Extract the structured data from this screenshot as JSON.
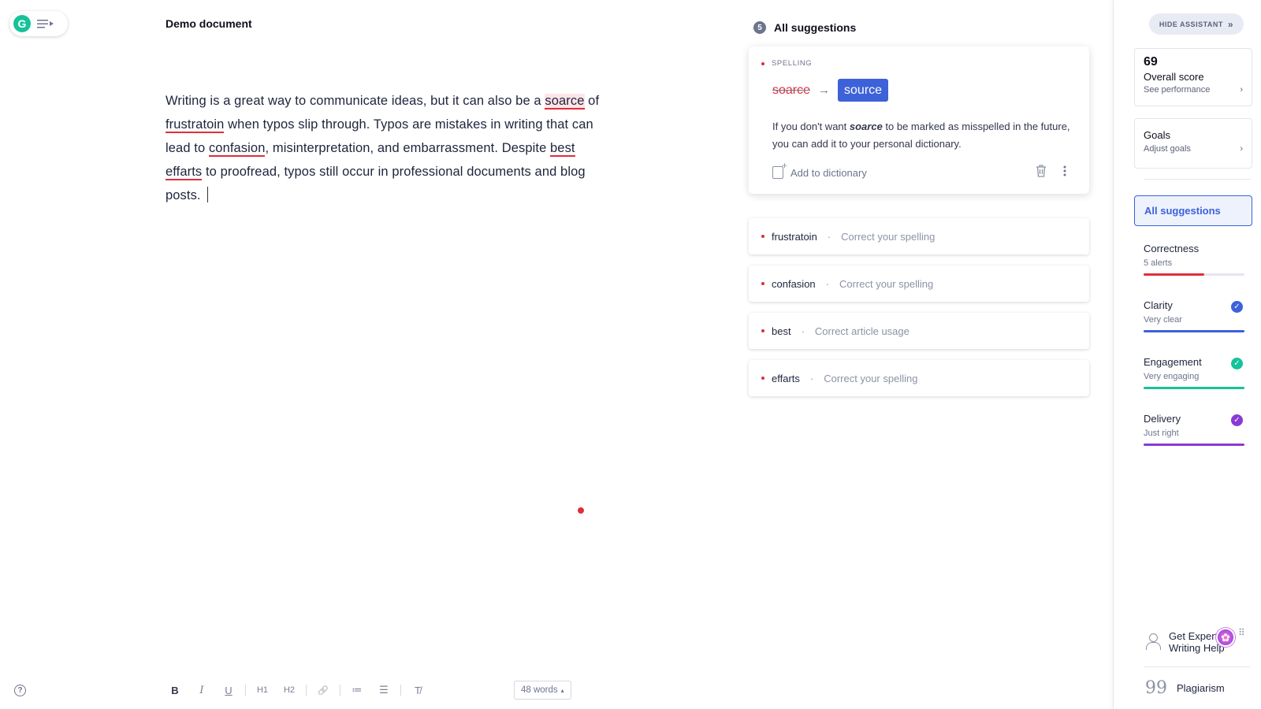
{
  "app": {
    "logo_letter": "G"
  },
  "document": {
    "title": "Demo document",
    "text": {
      "t1": "Writing is a great way to communicate ideas, but it can also be a ",
      "e1": "soarce",
      "t2": " of ",
      "e2": "frustratoin",
      "t3": " when typos slip through. Typos are mistakes in writing that can lead to ",
      "e3": "confasion",
      "t4": ", misinterpretation, and embarrassment. Despite ",
      "e4": "best",
      "t5": " ",
      "e5": "effarts",
      "t6": " to proofread, typos still occur in professional documents and blog posts. "
    }
  },
  "toolbar": {
    "bold": "B",
    "italic": "I",
    "underline": "U",
    "h1": "H1",
    "h2": "H2",
    "link": "🔗",
    "ordered_list": "≔",
    "bullet_list": "☰",
    "clear_format": "T̸",
    "word_count": "48 words",
    "word_count_caret": "▴",
    "help": "?"
  },
  "suggestions": {
    "count": "5",
    "title": "All suggestions",
    "active": {
      "category": "SPELLING",
      "original": "soarce",
      "arrow": "→",
      "replacement": "source",
      "desc_pre": "If you don't want ",
      "desc_word": "soarce",
      "desc_post": " to be marked as misspelled in the future, you can add it to your personal dictionary.",
      "add_label": "Add to dictionary"
    },
    "items": [
      {
        "word": "frustratoin",
        "desc": "Correct your spelling"
      },
      {
        "word": "confasion",
        "desc": "Correct your spelling"
      },
      {
        "word": "best",
        "desc": "Correct article usage"
      },
      {
        "word": "effarts",
        "desc": "Correct your spelling"
      }
    ],
    "separator": "·"
  },
  "sidebar": {
    "hide_label": "HIDE ASSISTANT",
    "hide_chevron": "»",
    "score": {
      "value": "69",
      "label": "Overall score",
      "sub": "See performance",
      "chevron": "›"
    },
    "goals": {
      "label": "Goals",
      "sub": "Adjust goals",
      "chevron": "›"
    },
    "all_suggestions": "All suggestions",
    "categories": [
      {
        "name": "Correctness",
        "sub": "5 alerts",
        "color": "#e02d3c",
        "level": 0.6
      },
      {
        "name": "Clarity",
        "sub": "Very clear",
        "color": "#3d61d9",
        "level": 1.0,
        "check": "✓"
      },
      {
        "name": "Engagement",
        "sub": "Very engaging",
        "color": "#15c39a",
        "level": 1.0,
        "check": "✓"
      },
      {
        "name": "Delivery",
        "sub": "Just right",
        "color": "#8a3ad4",
        "level": 1.0,
        "check": "✓"
      }
    ],
    "expert": "Get Expert Writing Help",
    "plagiarism": "Plagiarism",
    "quote_glyph": "99"
  }
}
